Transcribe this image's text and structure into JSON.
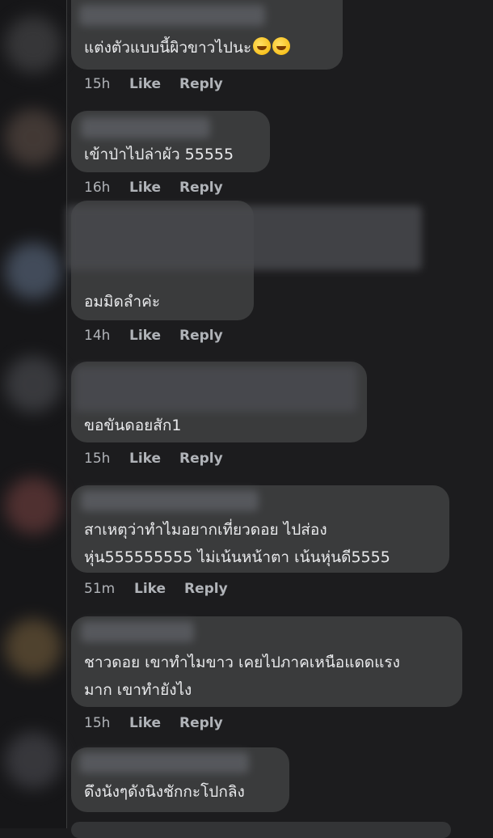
{
  "comments": [
    {
      "text": "แต่งตัวแบบนี้ผิวขาวไปนะ",
      "emoji": "🤣🤣",
      "time": "15h",
      "like": "Like",
      "reply": "Reply"
    },
    {
      "text": "เข้าป่าไปล่าผัว 55555",
      "time": "16h",
      "like": "Like",
      "reply": "Reply"
    },
    {
      "text": "อมมิดลำค่ะ",
      "time": "14h",
      "like": "Like",
      "reply": "Reply"
    },
    {
      "text": "ขอขันดอยสัก1",
      "time": "15h",
      "like": "Like",
      "reply": "Reply"
    },
    {
      "line1": "สาเหตุว่าทำไมอยากเที่ยวดอย ไปส่อง",
      "line2": "หุ่น555555555 ไม่เน้นหน้าตา เน้นหุ่นดี5555",
      "time": "51m",
      "like": "Like",
      "reply": "Reply"
    },
    {
      "line1": "ชาวดอย เขาทำไมขาว เคยไปภาคเหนือแดดแรง",
      "line2": "มาก เขาทำยังไง",
      "time": "15h",
      "like": "Like",
      "reply": "Reply"
    },
    {
      "text": "ดึงนังๆดังนิงชักกะโปกลิง"
    }
  ],
  "colors": {
    "bubble": "#3a3b3c",
    "background": "#1c1c1e",
    "meta": "#b0b3b8"
  },
  "icons": [
    "laughing-emoji-icon"
  ]
}
